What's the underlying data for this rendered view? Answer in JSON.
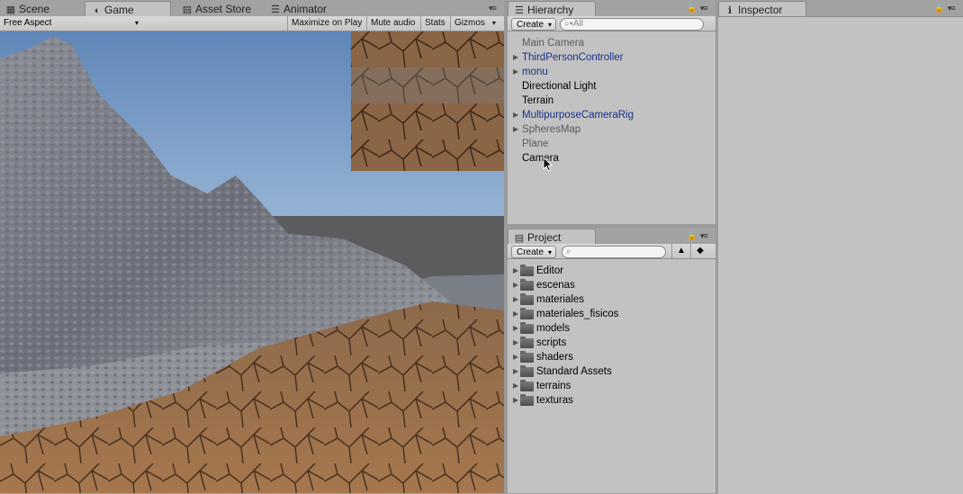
{
  "left_tabs": {
    "scene": "Scene",
    "game": "Game",
    "asset_store": "Asset Store",
    "animator": "Animator"
  },
  "game_toolbar": {
    "aspect": "Free Aspect",
    "maximize": "Maximize on Play",
    "mute": "Mute audio",
    "stats": "Stats",
    "gizmos": "Gizmos"
  },
  "hierarchy": {
    "tab": "Hierarchy",
    "create": "Create",
    "search_placeholder": "All",
    "items": [
      {
        "label": "Main Camera",
        "style": "grey",
        "expandable": false
      },
      {
        "label": "ThirdPersonController",
        "style": "prefab",
        "expandable": true
      },
      {
        "label": "monu",
        "style": "prefab",
        "expandable": true
      },
      {
        "label": "Directional Light",
        "style": "normal",
        "expandable": false
      },
      {
        "label": "Terrain",
        "style": "normal",
        "expandable": false
      },
      {
        "label": "MultipurposeCameraRig",
        "style": "prefab",
        "expandable": true
      },
      {
        "label": "SpheresMap",
        "style": "grey",
        "expandable": true
      },
      {
        "label": "Plane",
        "style": "grey",
        "expandable": false
      },
      {
        "label": "Camera",
        "style": "normal",
        "expandable": false
      }
    ]
  },
  "project": {
    "tab": "Project",
    "create": "Create",
    "folders": [
      "Editor",
      "escenas",
      "materiales",
      "materiales_fisicos",
      "models",
      "scripts",
      "shaders",
      "Standard Assets",
      "terrains",
      "texturas"
    ]
  },
  "inspector": {
    "tab": "Inspector"
  },
  "icons": {
    "scene": "grid-icon",
    "game": "pacman-icon",
    "asset_store": "bag-icon",
    "animator": "animator-icon",
    "hierarchy": "list-icon",
    "project": "folder-icon",
    "inspector": "info-icon",
    "lock": "lock-icon",
    "menu": "panel-menu-icon"
  }
}
